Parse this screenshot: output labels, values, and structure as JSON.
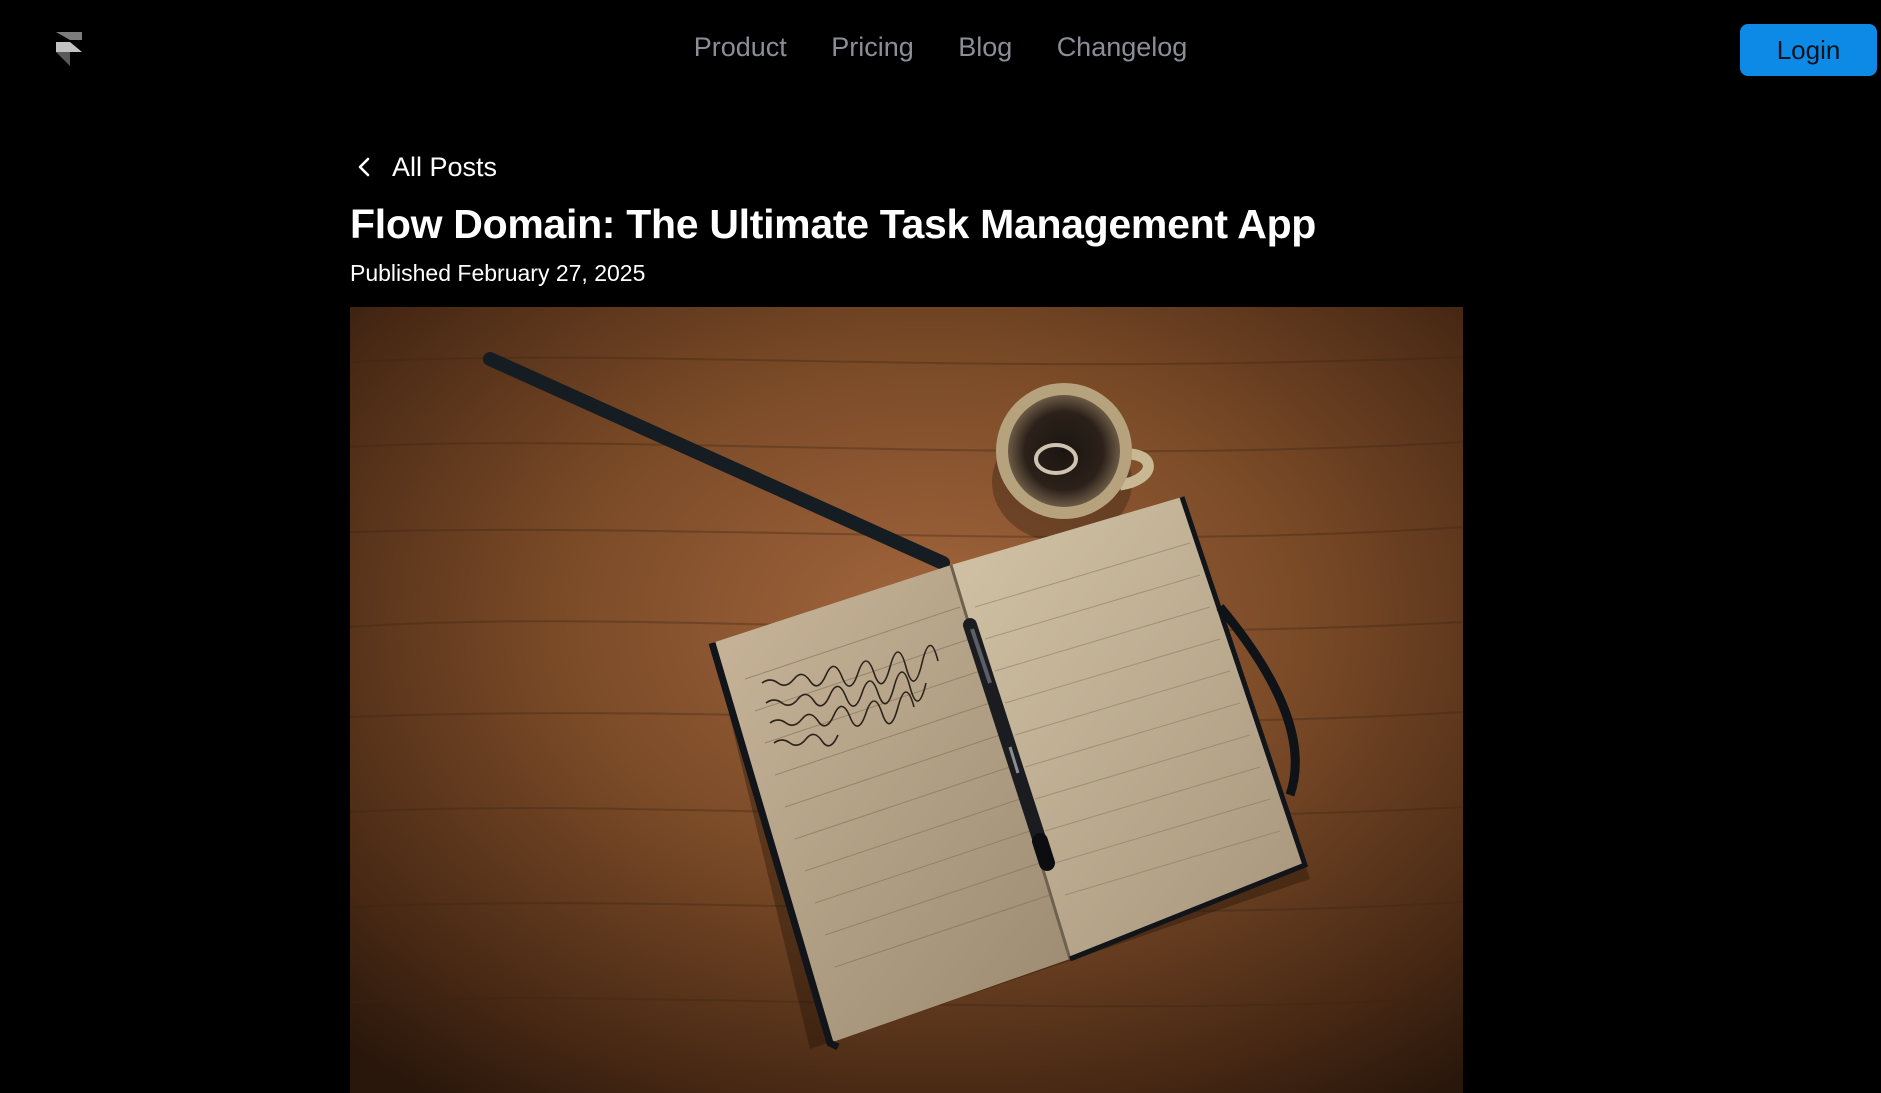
{
  "header": {
    "logo_icon": "framer-logo-icon",
    "nav": [
      "Product",
      "Pricing",
      "Blog",
      "Changelog"
    ],
    "login_label": "Login",
    "accent_color": "#0d8ae6"
  },
  "post": {
    "back_label": "All Posts",
    "back_icon": "chevron-left-icon",
    "title": "Flow Domain: The Ultimate Task Management App",
    "published": "Published February 27, 2025",
    "hero_image": "notebook-pen-coffee-photo"
  }
}
